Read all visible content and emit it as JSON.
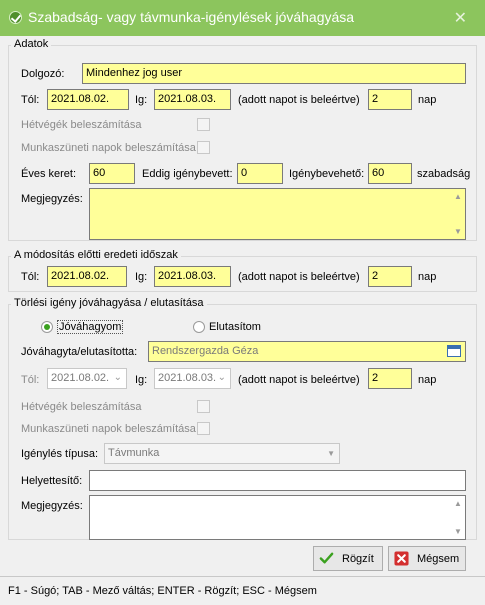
{
  "window": {
    "title": "Szabadság- vagy távmunka-igénylések jóváhagyása",
    "close_glyph": "✕"
  },
  "adatok": {
    "title": "Adatok",
    "dolgozo_label": "Dolgozó:",
    "dolgozo_value": "Mindenhez jog user",
    "tol_label": "Tól:",
    "tol_value": "2021.08.02.",
    "ig_label": "Ig:",
    "ig_value": "2021.08.03.",
    "adott_label": "(adott napot is beleértve)",
    "nap_value": "2",
    "nap_label": "nap",
    "hetvegek_label": "Hétvégék beleszámítása",
    "munkaszuneti_label": "Munkaszüneti napok beleszámítása",
    "eves_label": "Éves keret:",
    "eves_value": "60",
    "eddig_label": "Eddig igénybevett:",
    "eddig_value": "0",
    "igenybeveheto_label": "Igénybevehető:",
    "igenybeveheto_value": "60",
    "szabadsag_label": "szabadság",
    "megjegyzes_label": "Megjegyzés:",
    "megjegyzes_value": ""
  },
  "eredeti": {
    "title": "A módosítás előtti eredeti időszak",
    "tol_label": "Tól:",
    "tol_value": "2021.08.02.",
    "ig_label": "Ig:",
    "ig_value": "2021.08.03.",
    "adott_label": "(adott napot is beleértve)",
    "nap_value": "2",
    "nap_label": "nap"
  },
  "torlesi": {
    "title": "Törlési igény jóváhagyása / elutasítása",
    "jovahagyom_label": "Jóváhagyom",
    "elutasitom_label": "Elutasítom",
    "selected": "jovahagyom",
    "jovahagyta_label": "Jóváhagyta/elutasította:",
    "jovahagyta_value": "Rendszergazda Géza",
    "tol_label": "Tól:",
    "tol_value": "2021.08.02.",
    "ig_label": "Ig:",
    "ig_value": "2021.08.03.",
    "adott_label": "(adott napot is beleértve)",
    "nap_value": "2",
    "nap_label": "nap",
    "hetvegek_label": "Hétvégék beleszámítása",
    "munkaszuneti_label": "Munkaszüneti napok beleszámítása",
    "igenyles_tipusa_label": "Igénylés típusa:",
    "igenyles_tipusa_value": "Távmunka",
    "helyettesito_label": "Helyettesítő:",
    "helyettesito_value": "",
    "megjegyzes_label": "Megjegyzés:",
    "megjegyzes_value": ""
  },
  "buttons": {
    "rogzit_label": "Rögzít",
    "megsem_label": "Mégsem"
  },
  "status": {
    "text": "F1 - Súgó; TAB - Mező váltás; ENTER - Rögzít; ESC - Mégsem"
  },
  "colors": {
    "titlebar": "#8cc55d",
    "field_highlight": "#ffff99",
    "accent_green": "#3ba11f",
    "cancel_red": "#d32f2f"
  }
}
